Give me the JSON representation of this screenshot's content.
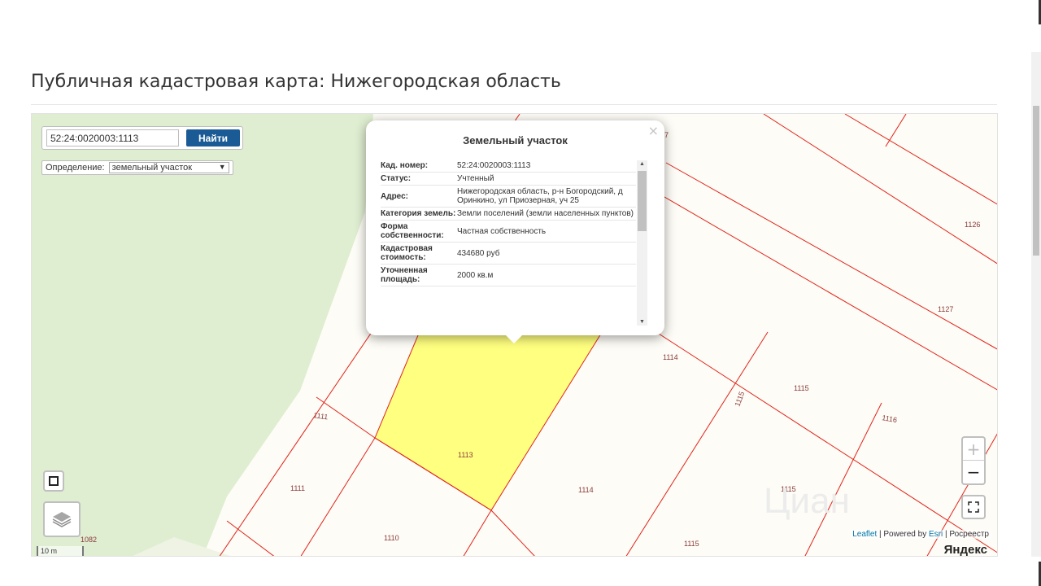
{
  "page": {
    "title": "Публичная кадастровая карта: Нижегородская область"
  },
  "search": {
    "value": "52:24:0020003:1113",
    "button_label": "Найти"
  },
  "definition": {
    "label": "Определение:",
    "selected": "земельный участок",
    "caret": "▼"
  },
  "popup": {
    "title": "Земельный участок",
    "close": "×",
    "rows": [
      {
        "label": "Кад. номер:",
        "value": "52:24:0020003:1113"
      },
      {
        "label": "Статус:",
        "value": "Учтенный"
      },
      {
        "label": "Адрес:",
        "value": "Нижегородская область, р-н Богородский, д Оринкино, ул Приозерная, уч 25"
      },
      {
        "label": "Категория земель:",
        "value": "Земли поселений (земли населенных пунктов)"
      },
      {
        "label": "Форма собственности:",
        "value": "Частная собственность"
      },
      {
        "label": "Кадастровая стоимость:",
        "value": "434680 руб"
      },
      {
        "label": "Уточненная площадь:",
        "value": "2000 кв.м"
      }
    ]
  },
  "parcels": {
    "n1113": "1113",
    "n1114": "1114",
    "n1115": "1115",
    "n1116": "1116",
    "n1110": "1110",
    "n1111": "1111",
    "n1126": "1126",
    "n1127": "1127",
    "n1082": "1082",
    "n7": "7"
  },
  "zoom": {
    "in": "+",
    "out": "−"
  },
  "attribution": {
    "leaflet": "Leaflet",
    "sep1": " | Powered by ",
    "esri": "Esri",
    "sep2": " | Росреестр"
  },
  "scale": {
    "label": "10 m"
  },
  "provider": {
    "label": "Яндекс"
  },
  "colors": {
    "selected_parcel": "#ffff80",
    "forest": "#dfeed1",
    "boundary": "#e2231a",
    "button": "#1a5b96"
  }
}
